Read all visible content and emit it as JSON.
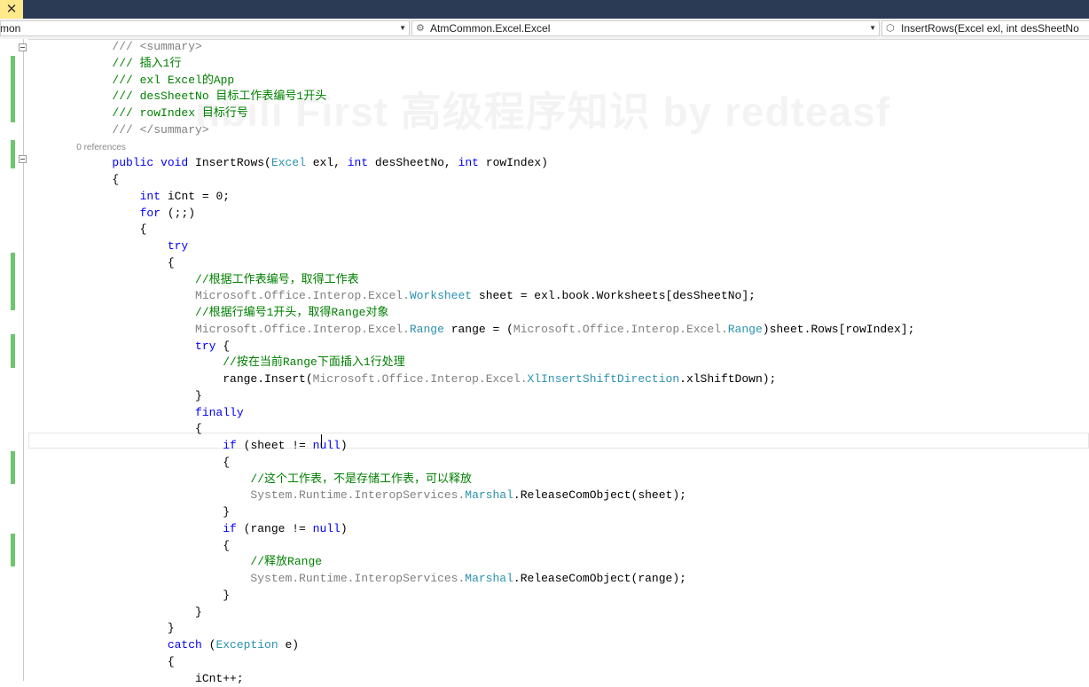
{
  "window": {
    "close_tab_glyph": "✕"
  },
  "navbar": {
    "project": "mon",
    "type": "AtmCommon.Excel.Excel",
    "member": "InsertRows(Excel exl, int desSheetNo"
  },
  "watermark": "nbili First 高级程序知识 by redteasf",
  "colors": {
    "keyword": "#0000ff",
    "comment": "#008000",
    "type": "#2b91af",
    "gray": "#808080",
    "change_bar": "#6cc76c"
  },
  "editor": {
    "lines": [
      [
        [
          "        /// <summary>",
          "k_gray"
        ]
      ],
      [
        [
          "        /// 插入1行",
          "k_comment"
        ]
      ],
      [
        [
          "        /// exl Excel的App",
          "k_comment"
        ]
      ],
      [
        [
          "        /// desSheetNo 目标工作表编号1开头",
          "k_comment"
        ]
      ],
      [
        [
          "        /// rowIndex 目标行号",
          "k_comment"
        ]
      ],
      [
        [
          "        /// </summary>",
          "k_gray"
        ]
      ],
      [
        [
          "        0 references",
          "k_ref"
        ]
      ],
      [
        [
          "        ",
          ""
        ],
        [
          "public void ",
          "k_kw"
        ],
        [
          "InsertRows(",
          ""
        ],
        [
          "Excel",
          "k_type"
        ],
        [
          " exl, ",
          ""
        ],
        [
          "int ",
          "k_kw"
        ],
        [
          "desSheetNo, ",
          ""
        ],
        [
          "int ",
          "k_kw"
        ],
        [
          "rowIndex)",
          ""
        ]
      ],
      [
        [
          "        {",
          ""
        ]
      ],
      [
        [
          "            ",
          ""
        ],
        [
          "int ",
          "k_kw"
        ],
        [
          "iCnt = 0;",
          ""
        ]
      ],
      [
        [
          "            ",
          ""
        ],
        [
          "for ",
          "k_kw"
        ],
        [
          "(;;)",
          ""
        ]
      ],
      [
        [
          "            {",
          ""
        ]
      ],
      [
        [
          "                ",
          ""
        ],
        [
          "try",
          "k_kw"
        ]
      ],
      [
        [
          "                {",
          ""
        ]
      ],
      [
        [
          "                    //根据工作表编号，取得工作表",
          "k_comment"
        ]
      ],
      [
        [
          "                    Microsoft.Office.Interop.Excel.",
          "k_gray"
        ],
        [
          "Worksheet",
          "k_type"
        ],
        [
          " sheet = exl.book.Worksheets[desSheetNo];",
          ""
        ]
      ],
      [
        [
          "                    //根据行编号1开头，取得Range对象",
          "k_comment"
        ]
      ],
      [
        [
          "                    Microsoft.Office.Interop.Excel.",
          "k_gray"
        ],
        [
          "Range",
          "k_type"
        ],
        [
          " range = (",
          ""
        ],
        [
          "Microsoft.Office.Interop.Excel.",
          "k_gray"
        ],
        [
          "Range",
          "k_type"
        ],
        [
          ")sheet.Rows[rowIndex];",
          ""
        ]
      ],
      [
        [
          "                    ",
          ""
        ],
        [
          "try ",
          "k_kw"
        ],
        [
          "{",
          ""
        ]
      ],
      [
        [
          "                        //按在当前Range下面插入1行处理",
          "k_comment"
        ]
      ],
      [
        [
          "                        range.Insert(",
          ""
        ],
        [
          "Microsoft.Office.Interop.Excel.",
          "k_gray"
        ],
        [
          "XlInsertShiftDirection",
          "k_type"
        ],
        [
          ".xlShiftDown);",
          ""
        ]
      ],
      [
        [
          "                    }",
          ""
        ]
      ],
      [
        [
          "                    ",
          ""
        ],
        [
          "finally",
          "k_kw"
        ]
      ],
      [
        [
          "                    {",
          ""
        ]
      ],
      [
        [
          "                        ",
          ""
        ],
        [
          "if ",
          "k_kw"
        ],
        [
          "(sheet != ",
          ""
        ],
        [
          "null",
          "k_kw"
        ],
        [
          ")",
          ""
        ]
      ],
      [
        [
          "                        {",
          ""
        ]
      ],
      [
        [
          "                            //这个工作表，不是存储工作表，可以释放",
          "k_comment"
        ]
      ],
      [
        [
          "                            System.Runtime.InteropServices.",
          "k_gray"
        ],
        [
          "Marshal",
          "k_type"
        ],
        [
          ".ReleaseComObject(sheet);",
          ""
        ]
      ],
      [
        [
          "                        }",
          ""
        ]
      ],
      [
        [
          "                        ",
          ""
        ],
        [
          "if ",
          "k_kw"
        ],
        [
          "(range != ",
          ""
        ],
        [
          "null",
          "k_kw"
        ],
        [
          ")",
          ""
        ]
      ],
      [
        [
          "                        {",
          ""
        ]
      ],
      [
        [
          "                            //释放Range",
          "k_comment"
        ]
      ],
      [
        [
          "                            System.Runtime.InteropServices.",
          "k_gray"
        ],
        [
          "Marshal",
          "k_type"
        ],
        [
          ".ReleaseComObject(range);",
          ""
        ]
      ],
      [
        [
          "                        }",
          ""
        ]
      ],
      [
        [
          "                    }",
          ""
        ]
      ],
      [
        [
          "                }",
          ""
        ]
      ],
      [
        [
          "                ",
          ""
        ],
        [
          "catch ",
          "k_kw"
        ],
        [
          "(",
          ""
        ],
        [
          "Exception",
          "k_type"
        ],
        [
          " e)",
          ""
        ]
      ],
      [
        [
          "                {",
          ""
        ]
      ],
      [
        [
          "                    iCnt++;",
          ""
        ]
      ]
    ]
  }
}
